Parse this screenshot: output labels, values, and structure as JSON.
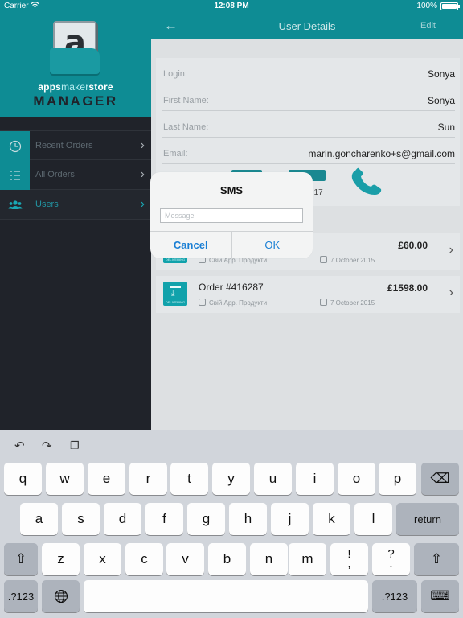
{
  "status_bar": {
    "carrier": "Carrier",
    "time": "12:08 PM",
    "battery": "100%",
    "battery_level": 1.0
  },
  "sidebar": {
    "brand_top_1": "apps",
    "brand_top_2": "maker",
    "brand_top_3": "store",
    "brand_bottom": "MANAGER",
    "items": [
      {
        "label": "Recent Orders",
        "icon": "clock-icon"
      },
      {
        "label": "All Orders",
        "icon": "list-icon"
      },
      {
        "label": "Users",
        "icon": "users-icon",
        "active": true
      }
    ]
  },
  "navbar": {
    "title": "User Details",
    "edit": "Edit"
  },
  "user": {
    "login_label": "Login:",
    "login_value": "Sonya",
    "first_name_label": "First Name:",
    "first_name_value": "Sonya",
    "last_name_label": "Last Name:",
    "last_name_value": "Sun",
    "email_label": "Email:",
    "email_value": "marin.goncharenko+s@gmail.com",
    "phone_fragment": "917"
  },
  "orders": [
    {
      "title": "",
      "price": "£60.00",
      "app": "Свій App. Продукти",
      "date": "7 October 2015"
    },
    {
      "title": "Order #416287",
      "price": "£1598.00",
      "app": "Свій App. Продукти",
      "date": "7 October 2015"
    }
  ],
  "order_icon_caption": "DELIVERING",
  "dialog": {
    "title": "SMS",
    "placeholder": "Message",
    "cancel": "Cancel",
    "ok": "OK"
  },
  "keyboard": {
    "row1": [
      "q",
      "w",
      "e",
      "r",
      "t",
      "y",
      "u",
      "i",
      "o",
      "p"
    ],
    "row2": [
      "a",
      "s",
      "d",
      "f",
      "g",
      "h",
      "j",
      "k",
      "l"
    ],
    "row3": [
      "z",
      "x",
      "c",
      "v",
      "b",
      "n",
      "m"
    ],
    "exclaim_top": "!",
    "exclaim_bottom": ",",
    "question_top": "?",
    "question_bottom": ".",
    "return": "return",
    "numbers": ".?123",
    "shift": "⇧",
    "backspace": "⌫",
    "globe": "🌐",
    "hide": "⌨",
    "undo": "↶",
    "redo": "↷",
    "paste": "❐"
  },
  "colors": {
    "accent": "#0e8c94",
    "sidebar_bg": "#20232a",
    "link": "#1a7fd4"
  }
}
